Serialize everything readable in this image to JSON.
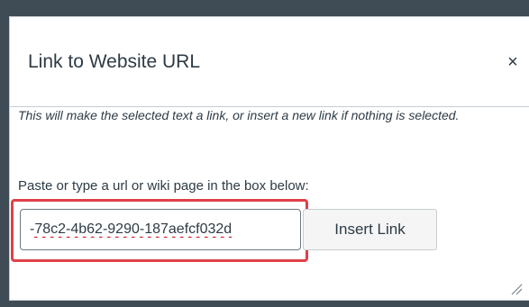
{
  "dialog": {
    "title": "Link to Website URL",
    "close_glyph": "×",
    "description": "This will make the selected text a link, or insert a new link if nothing is selected.",
    "instruction": "Paste or type a url or wiki page in the box below:",
    "url_input": {
      "value": "-78c2-4b62-9290-187aefcf032d"
    },
    "insert_button_label": "Insert Link",
    "highlight_color": "#e0404a"
  }
}
